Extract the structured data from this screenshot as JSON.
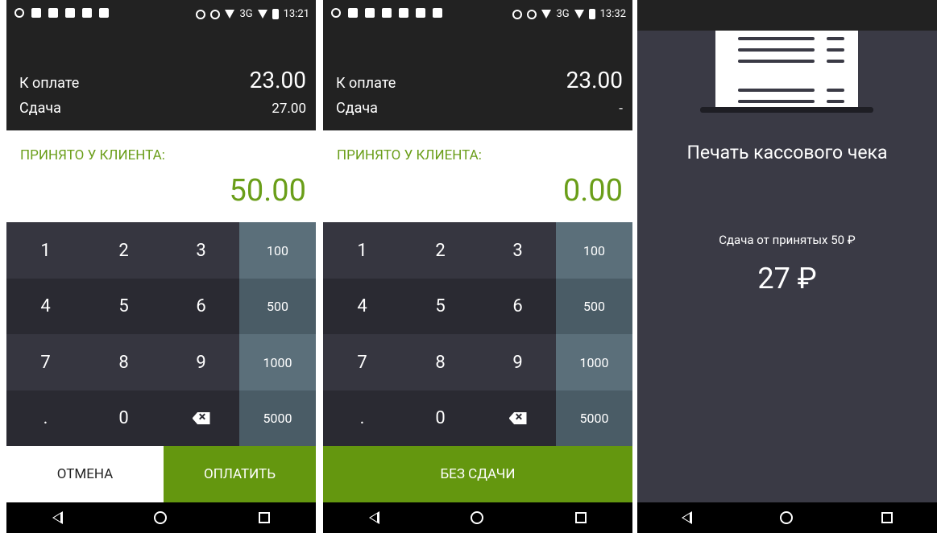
{
  "screen1": {
    "status_time": "13:21",
    "status_network": "3G",
    "to_pay_label": "К оплате",
    "to_pay_value": "23.00",
    "change_label": "Сдача",
    "change_value": "27.00",
    "received_label": "ПРИНЯТО У КЛИЕНТА:",
    "received_value": "50.00",
    "cancel_label": "ОТМЕНА",
    "pay_label": "ОПЛАТИТЬ"
  },
  "screen2": {
    "status_time": "13:32",
    "status_network": "3G",
    "to_pay_label": "К оплате",
    "to_pay_value": "23.00",
    "change_label": "Сдача",
    "change_value": "-",
    "received_label": "ПРИНЯТО У КЛИЕНТА:",
    "received_value": "0.00",
    "no_change_label": "БЕЗ СДАЧИ"
  },
  "keypad": {
    "k1": "1",
    "k2": "2",
    "k3": "3",
    "q1": "100",
    "k4": "4",
    "k5": "5",
    "k6": "6",
    "q2": "500",
    "k7": "7",
    "k8": "8",
    "k9": "9",
    "q3": "1000",
    "kdot": ".",
    "k0": "0",
    "q4": "5000"
  },
  "screen3": {
    "title": "Печать кассового чека",
    "subtitle": "Сдача от принятых 50 ₽",
    "amount": "27 ₽"
  },
  "colors": {
    "accent_green": "#64970f",
    "dark_header": "#222222",
    "keypad_dark": "#2a2a32",
    "keypad_quick": "#5b6f7a"
  },
  "icons": {
    "backspace": "backspace-icon",
    "nav": [
      "back-icon",
      "home-icon",
      "recents-icon"
    ]
  }
}
